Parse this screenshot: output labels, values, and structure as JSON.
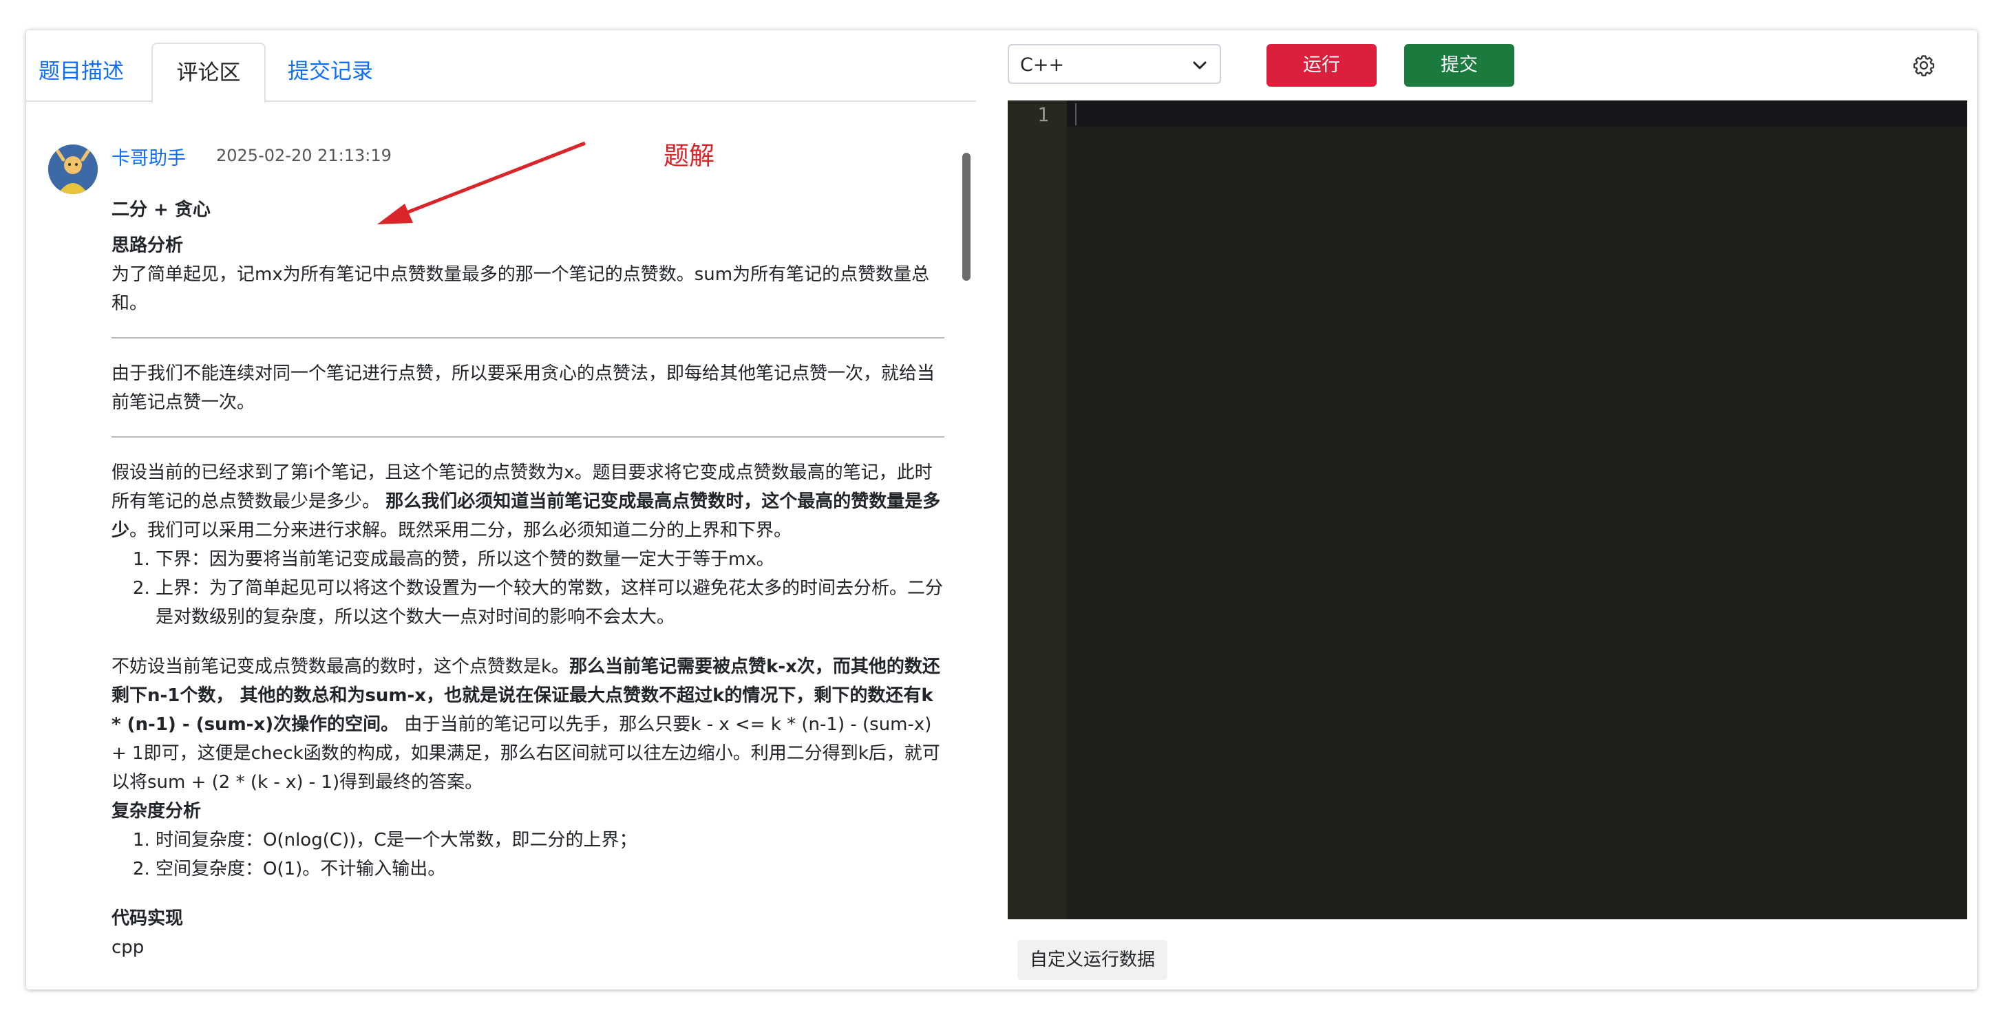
{
  "tabs": [
    {
      "label": "题目描述"
    },
    {
      "label": "评论区"
    },
    {
      "label": "提交记录"
    }
  ],
  "comment": {
    "author": "卡哥助手",
    "time": "2025-02-20 21:13:19",
    "title": "二分 + 贪心",
    "section1": "思路分析",
    "p1": "为了简单起见，记mx为所有笔记中点赞数量最多的那一个笔记的点赞数。sum为所有笔记的点赞数量总和。",
    "p2": "由于我们不能连续对同一个笔记进行点赞，所以要采用贪心的点赞法，即每给其他笔记点赞一次，就给当前笔记点赞一次。",
    "p3a": "假设当前的已经求到了第i个笔记，且这个笔记的点赞数为x。题目要求将它变成点赞数最高的笔记，此时所有笔记的总点赞数最少是多少。 ",
    "p3b": "那么我们必须知道当前笔记变成最高点赞数时，这个最高的赞数量是多少",
    "p3c": "。我们可以采用二分来进行求解。既然采用二分，那么必须知道二分的上界和下界。",
    "list1": [
      "下界：因为要将当前笔记变成最高的赞，所以这个赞的数量一定大于等于mx。",
      "上界：为了简单起见可以将这个数设置为一个较大的常数，这样可以避免花太多的时间去分析。二分是对数级别的复杂度，所以这个数大一点对时间的影响不会太大。"
    ],
    "p4a": "不妨设当前笔记变成点赞数最高的数时，这个点赞数是k。",
    "p4b": "那么当前笔记需要被点赞k-x次，而其他的数还剩下n-1个数， 其他的数总和为sum-x，也就是说在保证最大点赞数不超过k的情况下，剩下的数还有k * (n-1) - (sum-x)次操作的空间。",
    "p4c": " 由于当前的笔记可以先手，那么只要k - x <= k * (n-1) - (sum-x) + 1即可，这便是check函数的构成，如果满足，那么右区间就可以往左边缩小。利用二分得到k后，就可以将sum + (2 * (k - x) - 1)得到最终的答案。",
    "section2": "复杂度分析",
    "list2": [
      "时间复杂度：O(nlog(C))，C是一个大常数，即二分的上界；",
      "空间复杂度：O(1)。不计输入输出。"
    ],
    "section3": "代码实现",
    "code_lang": "cpp"
  },
  "annotation": {
    "text": "题解",
    "color": "#d9262b"
  },
  "editor": {
    "language": "C++",
    "run_label": "运行",
    "submit_label": "提交",
    "line_numbers": [
      "1"
    ],
    "custom_data_label": "自定义运行数据"
  },
  "colors": {
    "run": "#dc1f3c",
    "submit": "#1b7a3e",
    "link": "#0d6efd",
    "editor_bg": "#1f201c"
  },
  "icons": [
    "chevron-down-icon",
    "gear-icon",
    "avatar-image"
  ]
}
